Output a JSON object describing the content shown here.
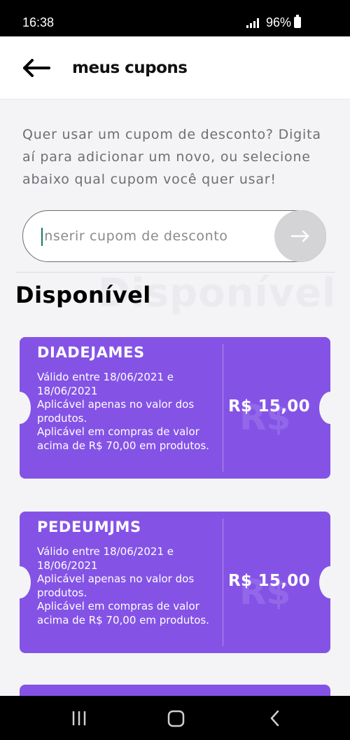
{
  "status_bar": {
    "time": "16:38",
    "battery": "96%"
  },
  "header": {
    "title": "meus cupons",
    "back_icon": "arrow-left-icon"
  },
  "intro_text": "Quer usar um cupom de desconto? Digita aí para adicionar um novo, ou selecione abaixo qual cupom você quer usar!",
  "coupon_input": {
    "value": "",
    "placeholder": "Inserir cupom de desconto",
    "submit_icon": "arrow-right-icon"
  },
  "section": {
    "title": "Disponível",
    "ghost": "Disponível"
  },
  "coupons": [
    {
      "code": "DIADEJAMES",
      "validity": "Válido entre 18/06/2021 e 18/06/2021",
      "rule_1": "Aplicável apenas no valor dos produtos.",
      "rule_2": "Aplicável em compras de valor acima de R$ 70,00 em produtos.",
      "currency_ghost": "R$",
      "value": "R$ 15,00"
    },
    {
      "code": "PEDEUMJMS",
      "validity": "Válido entre 18/06/2021 e 18/06/2021",
      "rule_1": "Aplicável apenas no valor dos produtos.",
      "rule_2": "Aplicável em compras de valor acima de R$ 70,00 em produtos.",
      "currency_ghost": "R$",
      "value": "R$ 15,00"
    }
  ],
  "nav_bar": {
    "recents_icon": "recents-icon",
    "home_icon": "home-icon",
    "back_icon": "chevron-left-icon"
  },
  "colors": {
    "accent": "#8453e6",
    "background": "#f4f4f6",
    "button_disabled": "#d4d4d7"
  }
}
